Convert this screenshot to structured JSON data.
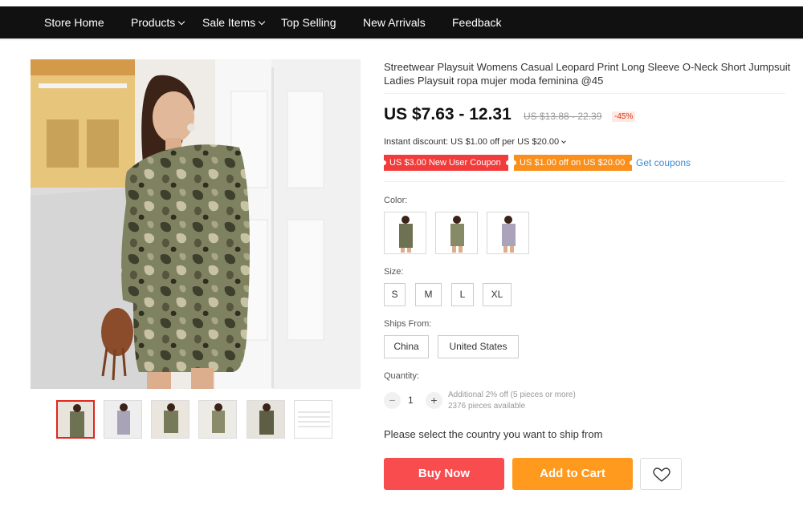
{
  "nav": {
    "items": [
      {
        "label": "Store Home",
        "has_dropdown": false
      },
      {
        "label": "Products",
        "has_dropdown": true
      },
      {
        "label": "Sale Items",
        "has_dropdown": true
      },
      {
        "label": "Top Selling",
        "has_dropdown": false
      },
      {
        "label": "New Arrivals",
        "has_dropdown": false
      },
      {
        "label": "Feedback",
        "has_dropdown": false
      }
    ]
  },
  "product": {
    "title": "Streetwear Playsuit Womens Casual Leopard Print Long Sleeve O-Neck Short Jumpsuit Ladies Playsuit ropa mujer moda feminina @45",
    "price": "US $7.63 - 12.31",
    "original_price": "US $13.88 - 22.39",
    "discount": "-45%",
    "instant_discount": "Instant discount: US $1.00 off per US $20.00",
    "coupons": [
      {
        "label": "US $3.00 New User Coupon",
        "color": "#f23c3c"
      },
      {
        "label": "US $1.00 off on US $20.00",
        "color": "#fa8f1c"
      }
    ],
    "get_coupons": "Get coupons"
  },
  "options": {
    "color_label": "Color:",
    "colors": [
      "camo-olive-icon",
      "camo-green-icon",
      "camo-lavender-icon"
    ],
    "size_label": "Size:",
    "sizes": [
      "S",
      "M",
      "L",
      "XL"
    ],
    "ships_label": "Ships From:",
    "ships_from": [
      "China",
      "United States"
    ],
    "quantity_label": "Quantity:",
    "quantity_value": "1",
    "qty_minus": "−",
    "qty_plus": "+",
    "qty_note_line1": "Additional 2% off (5 pieces or more)",
    "qty_note_line2": "2376 pieces available"
  },
  "ship_message": "Please select the country you want to ship from",
  "actions": {
    "buy_now": "Buy Now",
    "add_to_cart": "Add to Cart"
  },
  "gallery": {
    "thumbnail_count": 6,
    "active_index": 0
  },
  "colors": {
    "nav_bg": "#111111",
    "buy_now": "#f94c4f",
    "add_to_cart": "#ff9a1e",
    "link": "#3d8bd0"
  }
}
